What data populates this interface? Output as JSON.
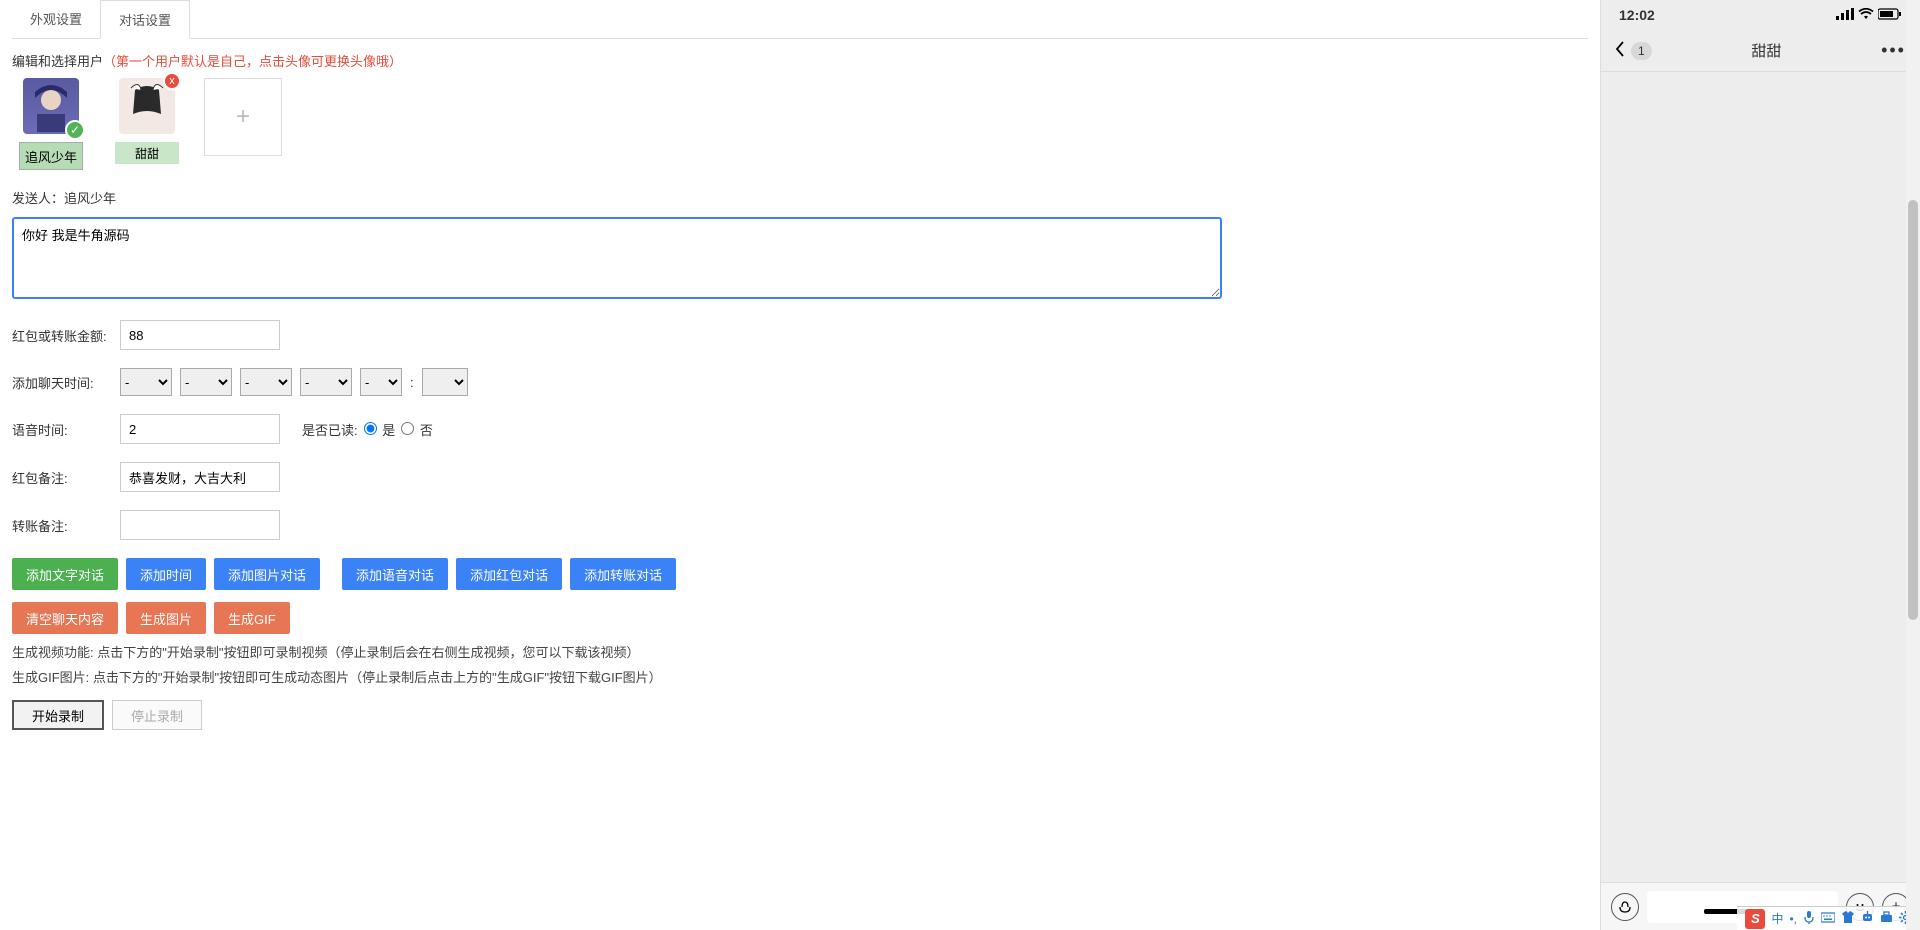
{
  "tabs": {
    "appearance": "外观设置",
    "dialog": "对话设置"
  },
  "editUserLabel": "编辑和选择用户",
  "editUserHint": "（第一个用户默认是自己，点击头像可更换头像哦）",
  "users": [
    {
      "name": "追风少年",
      "selected": true
    },
    {
      "name": "甜甜",
      "selected": false
    }
  ],
  "sender": {
    "prefix": "发送人：",
    "name": "追风少年"
  },
  "messageText": "你好 我是牛角源码",
  "amount": {
    "label": "红包或转账金额:",
    "value": "88"
  },
  "chatTime": {
    "label": "添加聊天时间:",
    "y": "-",
    "mo": "-",
    "d": "-",
    "h": "-",
    "mi": "-",
    "colon": ":",
    "s": ""
  },
  "voice": {
    "label": "语音时间:",
    "value": "2"
  },
  "read": {
    "label": "是否已读:",
    "yes": "是",
    "no": "否"
  },
  "redNote": {
    "label": "红包备注:",
    "value": "恭喜发财，大吉大利"
  },
  "transferNote": {
    "label": "转账备注:",
    "value": ""
  },
  "buttons": {
    "addText": "添加文字对话",
    "addTime": "添加时间",
    "addImage": "添加图片对话",
    "addVoice": "添加语音对话",
    "addRed": "添加红包对话",
    "addTransfer": "添加转账对话",
    "clear": "清空聊天内容",
    "genImg": "生成图片",
    "genGif": "生成GIF",
    "startRec": "开始录制",
    "stopRec": "停止录制"
  },
  "infoVideo": "生成视频功能: 点击下方的\"开始录制\"按钮即可录制视频（停止录制后会在右侧生成视频，您可以下载该视频）",
  "infoGif": "生成GIF图片: 点击下方的\"开始录制\"按钮即可生成动态图片（停止录制后点击上方的\"生成GIF\"按钮下载GIF图片）",
  "phone": {
    "time": "12:02",
    "backCount": "1",
    "title": "甜甜"
  },
  "ime": {
    "logo": "S",
    "items": [
      "中",
      "•,"
    ]
  }
}
